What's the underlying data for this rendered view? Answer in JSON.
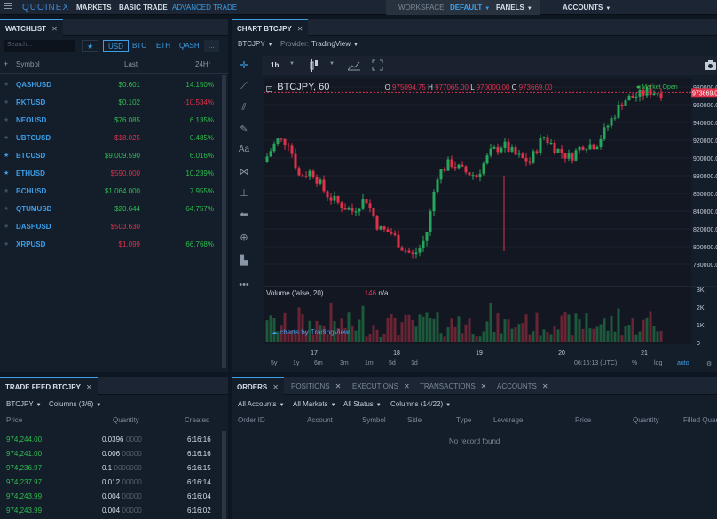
{
  "topbar": {
    "logo": "QUOINEX",
    "nav": [
      "MARKETS",
      "BASIC TRADE",
      "ADVANCED TRADE"
    ],
    "workspace_label": "WORKSPACE:",
    "workspace_value": "DEFAULT",
    "panels": "PANELS",
    "accounts": "ACCOUNTS"
  },
  "watchlist": {
    "tab": "WATCHLIST",
    "search_placeholder": "Search...",
    "filters": [
      "USD",
      "BTC",
      "ETH",
      "QASH",
      "..."
    ],
    "headers": {
      "symbol": "Symbol",
      "last": "Last",
      "change": "24Hr"
    },
    "rows": [
      {
        "star": false,
        "symbol": "QASHUSD",
        "last": "$0.601",
        "last_dir": "up",
        "change": "14.150%",
        "change_dir": "up"
      },
      {
        "star": false,
        "symbol": "RKTUSD",
        "last": "$0.102",
        "last_dir": "up",
        "change": "-10.534%",
        "change_dir": "dn"
      },
      {
        "star": false,
        "symbol": "NEOUSD",
        "last": "$76.085",
        "last_dir": "up",
        "change": "6.135%",
        "change_dir": "up"
      },
      {
        "star": false,
        "symbol": "UBTCUSD",
        "last": "$18.025",
        "last_dir": "dn",
        "change": "0.485%",
        "change_dir": "up"
      },
      {
        "star": true,
        "symbol": "BTCUSD",
        "last": "$9,009.590",
        "last_dir": "up",
        "change": "6.016%",
        "change_dir": "up"
      },
      {
        "star": true,
        "symbol": "ETHUSD",
        "last": "$590.000",
        "last_dir": "dn",
        "change": "10.239%",
        "change_dir": "up"
      },
      {
        "star": false,
        "symbol": "BCHUSD",
        "last": "$1,064.000",
        "last_dir": "up",
        "change": "7.955%",
        "change_dir": "up"
      },
      {
        "star": false,
        "symbol": "QTUMUSD",
        "last": "$20.644",
        "last_dir": "up",
        "change": "64.757%",
        "change_dir": "up"
      },
      {
        "star": false,
        "symbol": "DASHUSD",
        "last": "$503.630",
        "last_dir": "dn",
        "change": "",
        "change_dir": "up"
      },
      {
        "star": false,
        "symbol": "XRPUSD",
        "last": "$1.099",
        "last_dir": "dn",
        "change": "66.768%",
        "change_dir": "up"
      }
    ]
  },
  "chart": {
    "tab": "CHART BTCJPY",
    "pair": "BTCJPY",
    "provider_label": "Provider:",
    "provider": "TradingView",
    "interval": "1h",
    "title": "BTCJPY, 60",
    "ohlc": {
      "o_label": "O",
      "o": "975094.75",
      "h_label": "H",
      "h": "977065.00",
      "l_label": "L",
      "l": "970000.00",
      "c_label": "C",
      "c": "973669.00"
    },
    "market_status": "Market Open",
    "current_price": "973669.0",
    "volume_label": "Volume (false, 20)",
    "volume_value": "146",
    "volume_na": "n/a",
    "watermark": "charts by TradingView",
    "price_ticks": [
      "980000.0",
      "960000.0",
      "940000.0",
      "920000.0",
      "900000.0",
      "880000.0",
      "860000.0",
      "840000.0",
      "820000.0",
      "800000.0",
      "780000.0"
    ],
    "volume_ticks": [
      "3K",
      "2K",
      "1K",
      "0"
    ],
    "date_ticks": [
      "17",
      "18",
      "19",
      "20",
      "21"
    ],
    "ranges": [
      "5y",
      "1y",
      "6m",
      "3m",
      "1m",
      "5d",
      "1d"
    ],
    "time": "06:16:13 (UTC)",
    "pct": "%",
    "log": "log",
    "auto": "auto",
    "colors": {
      "up": "#26a65b",
      "down": "#e0314b",
      "bg": "#131722"
    }
  },
  "trade_feed": {
    "tab": "TRADE FEED BTCJPY",
    "pair": "BTCJPY",
    "columns": "Columns (3/6)",
    "headers": {
      "price": "Price",
      "quantity": "Quantity",
      "created": "Created"
    },
    "rows": [
      {
        "price": "974,244.00",
        "qty_main": "0.0396",
        "qty_zero": "0000",
        "created": "6:16:16"
      },
      {
        "price": "974,241.00",
        "qty_main": "0.006",
        "qty_zero": "00000",
        "created": "6:16:16"
      },
      {
        "price": "974,236.97",
        "qty_main": "0.1",
        "qty_zero": "0000000",
        "created": "6:16:15"
      },
      {
        "price": "974,237.97",
        "qty_main": "0.012",
        "qty_zero": "00000",
        "created": "6:16:14"
      },
      {
        "price": "974,243.99",
        "qty_main": "0.004",
        "qty_zero": "00000",
        "created": "6:16:04"
      },
      {
        "price": "974,243.99",
        "qty_main": "0.004",
        "qty_zero": "00000",
        "created": "6:16:02"
      }
    ]
  },
  "orders": {
    "tabs": [
      "ORDERS",
      "POSITIONS",
      "EXECUTIONS",
      "TRANSACTIONS",
      "ACCOUNTS"
    ],
    "filters": [
      "All Accounts",
      "All Markets",
      "All Status",
      "Columns (14/22)"
    ],
    "headers": [
      "Order ID",
      "Account",
      "Symbol",
      "Side",
      "Type",
      "Leverage",
      "Price",
      "Quantity",
      "Filled Quan"
    ],
    "empty": "No record found"
  }
}
